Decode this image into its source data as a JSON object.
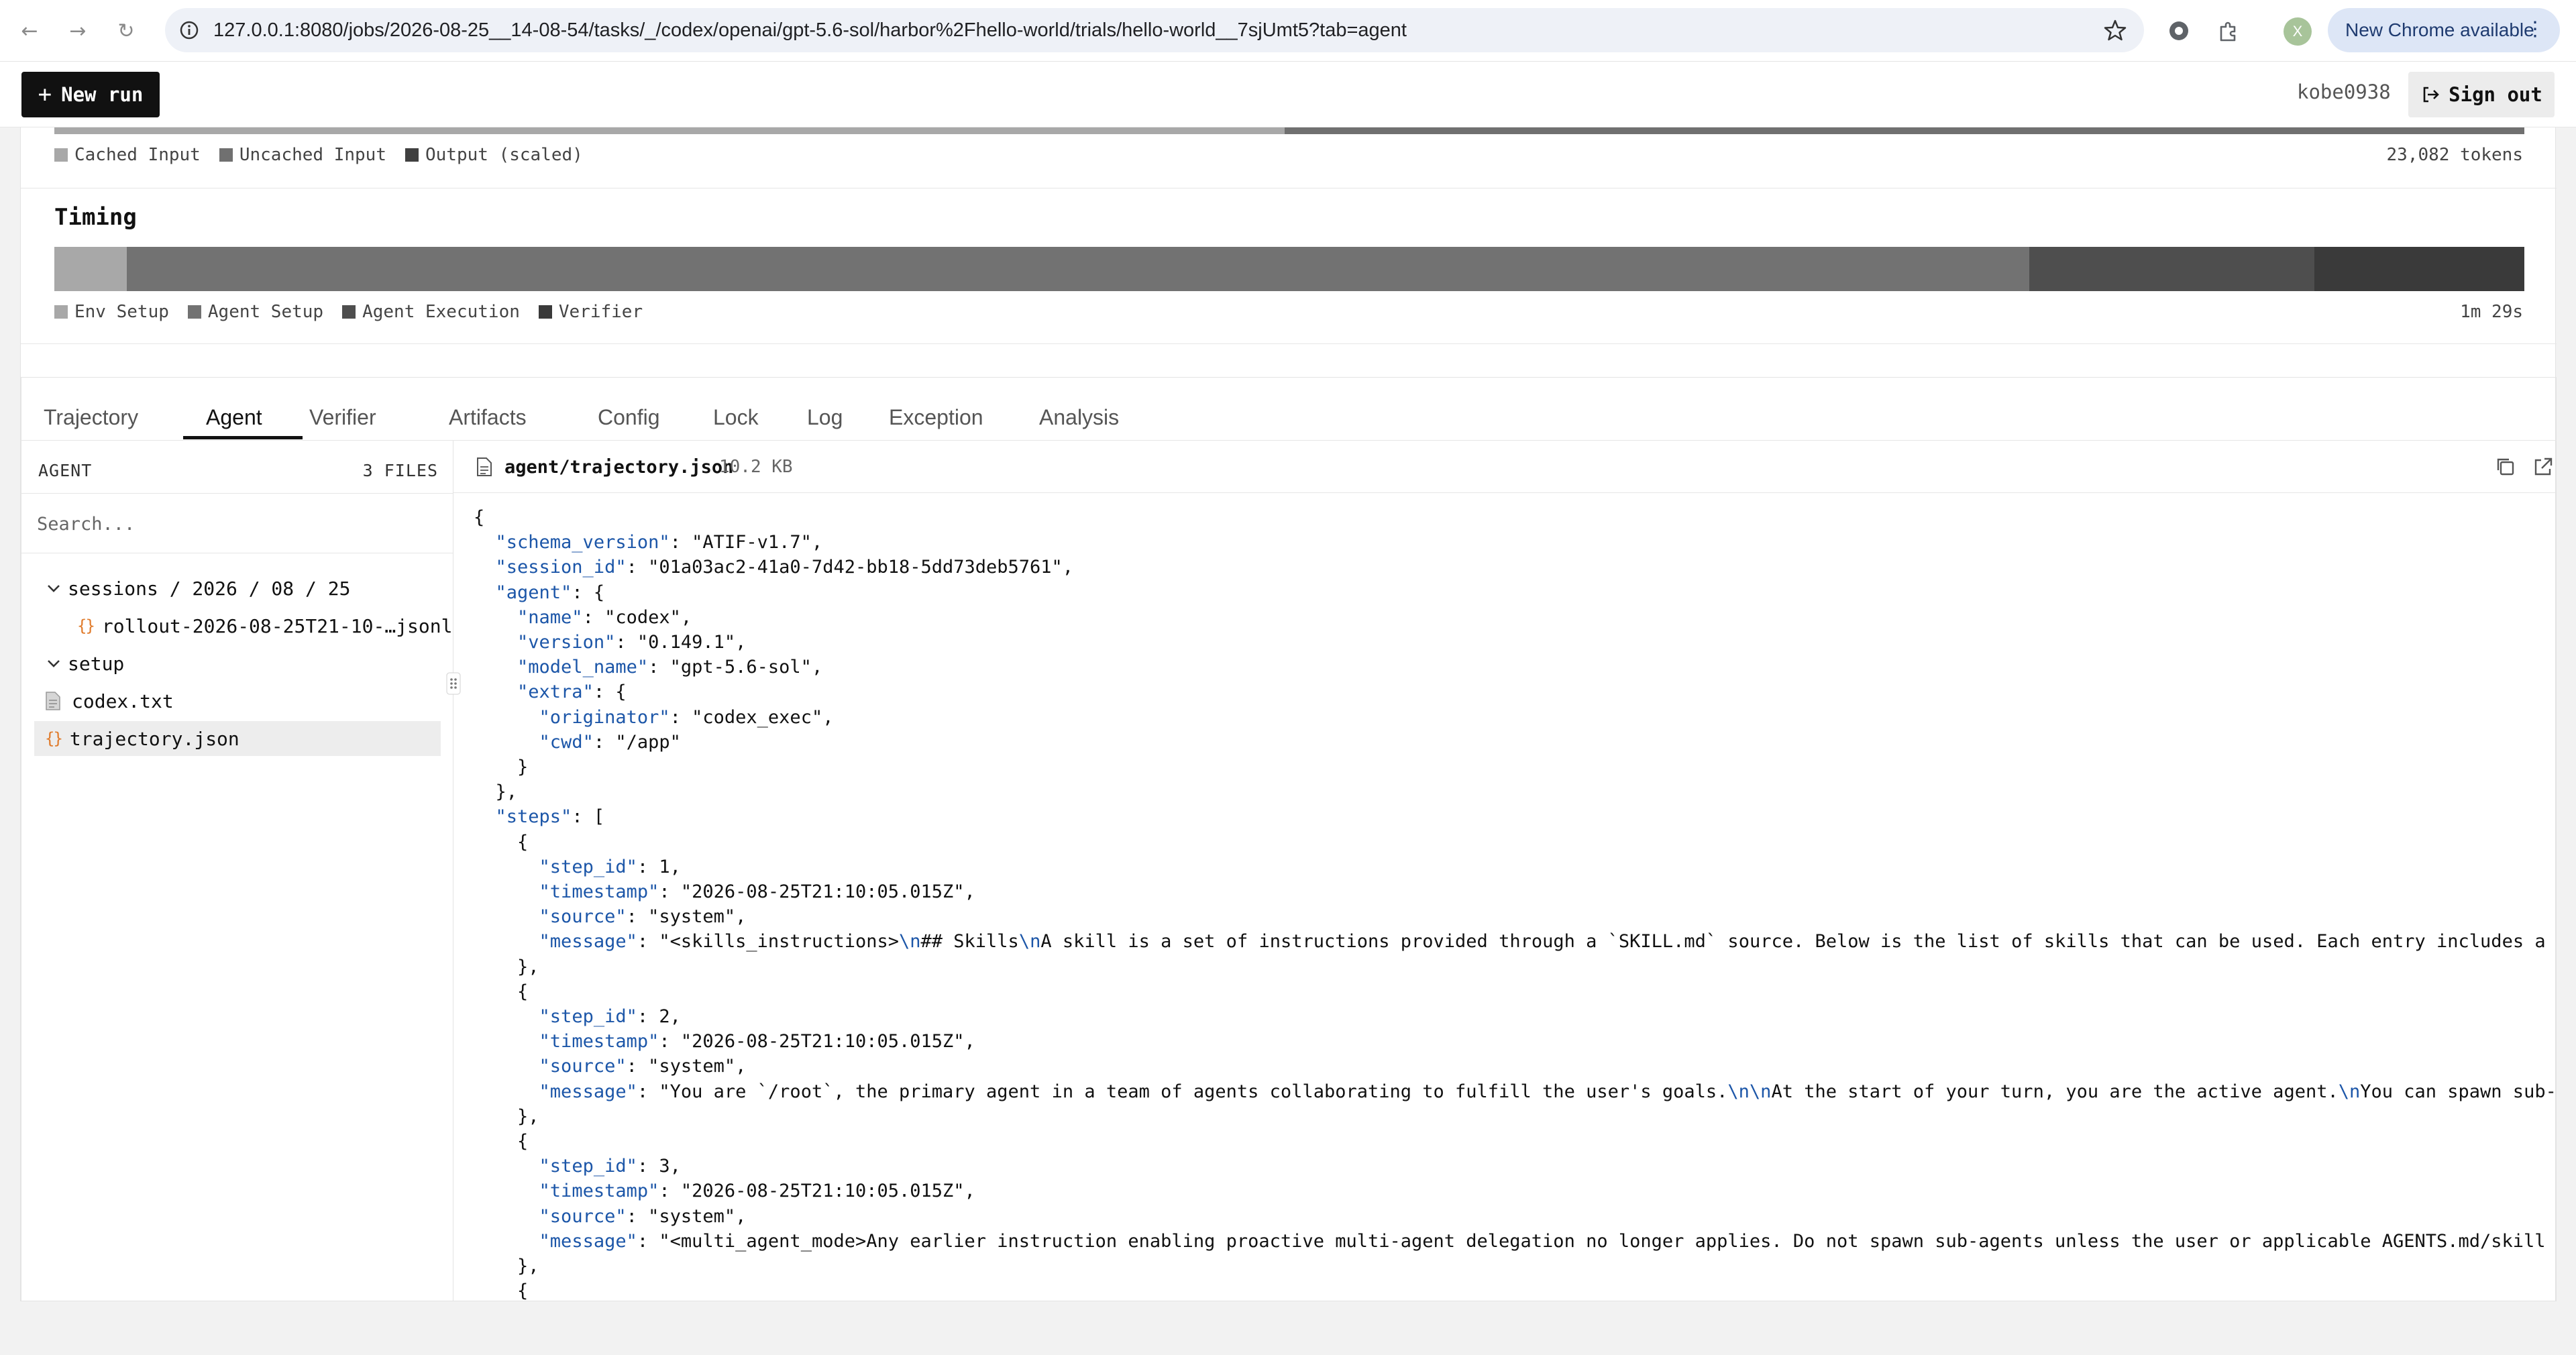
{
  "browser": {
    "url": "127.0.0.1:8080/jobs/2026-08-25__14-08-54/tasks/_/codex/openai/gpt-5.6-sol/harbor%2Fhello-world/trials/hello-world__7sjUmt5?tab=agent",
    "profile_initial": "X",
    "update_label": "New Chrome available"
  },
  "header": {
    "new_run_label": "New run",
    "username": "kobe0938",
    "signout_label": "Sign out"
  },
  "tokens": {
    "legend": [
      "Cached Input",
      "Uncached Input",
      "Output (scaled)"
    ],
    "legend_colors": [
      "#a8a8a8",
      "#707070",
      "#404040"
    ],
    "total": "23,082 tokens"
  },
  "timing": {
    "title": "Timing",
    "legend": [
      "Env Setup",
      "Agent Setup",
      "Agent Execution",
      "Verifier"
    ],
    "legend_colors": [
      "#a8a8a8",
      "#727272",
      "#4e4e4e",
      "#3a3a3a"
    ],
    "total": "1m 29s"
  },
  "tabs": [
    "Trajectory",
    "Agent",
    "Verifier",
    "Artifacts",
    "Config",
    "Lock",
    "Log",
    "Exception",
    "Analysis"
  ],
  "active_tab": "Agent",
  "sidebar": {
    "heading": "AGENT",
    "file_count": "3 FILES",
    "search_placeholder": "Search...",
    "tree": [
      {
        "label": "sessions / 2026 / 08 / 25",
        "type": "folder"
      },
      {
        "label": "rollout-2026-08-25T21-10-…jsonl",
        "type": "json"
      },
      {
        "label": "setup",
        "type": "folder"
      },
      {
        "label": "codex.txt",
        "type": "file"
      },
      {
        "label": "trajectory.json",
        "type": "json",
        "selected": true
      }
    ]
  },
  "viewer": {
    "path": "agent/trajectory.json",
    "size": "10.2 KB",
    "lines": [
      "{",
      "  \"schema_version\": \"ATIF-v1.7\",",
      "  \"session_id\": \"01a03ac2-41a0-7d42-bb18-5dd73deb5761\",",
      "  \"agent\": {",
      "    \"name\": \"codex\",",
      "    \"version\": \"0.149.1\",",
      "    \"model_name\": \"gpt-5.6-sol\",",
      "    \"extra\": {",
      "      \"originator\": \"codex_exec\",",
      "      \"cwd\": \"/app\"",
      "    }",
      "  },",
      "  \"steps\": [",
      "    {",
      "      \"step_id\": 1,",
      "      \"timestamp\": \"2026-08-25T21:10:05.015Z\",",
      "      \"source\": \"system\",",
      "      \"message\": \"<skills_instructions>\\n## Skills\\nA skill is a set of instructions provided through a `SKILL.md` source. Below is the list of skills that can be used. Each entry includes a name, de",
      "    },",
      "    {",
      "      \"step_id\": 2,",
      "      \"timestamp\": \"2026-08-25T21:10:05.015Z\",",
      "      \"source\": \"system\",",
      "      \"message\": \"You are `/root`, the primary agent in a team of agents collaborating to fulfill the user's goals.\\n\\nAt the start of your turn, you are the active agent.\\nYou can spawn sub-agents t",
      "    },",
      "    {",
      "      \"step_id\": 3,",
      "      \"timestamp\": \"2026-08-25T21:10:05.015Z\",",
      "      \"source\": \"system\",",
      "      \"message\": \"<multi_agent_mode>Any earlier instruction enabling proactive multi-agent delegation no longer applies. Do not spawn sub-agents unless the user or applicable AGENTS.md/skill instruct",
      "    },",
      "    {"
    ]
  }
}
